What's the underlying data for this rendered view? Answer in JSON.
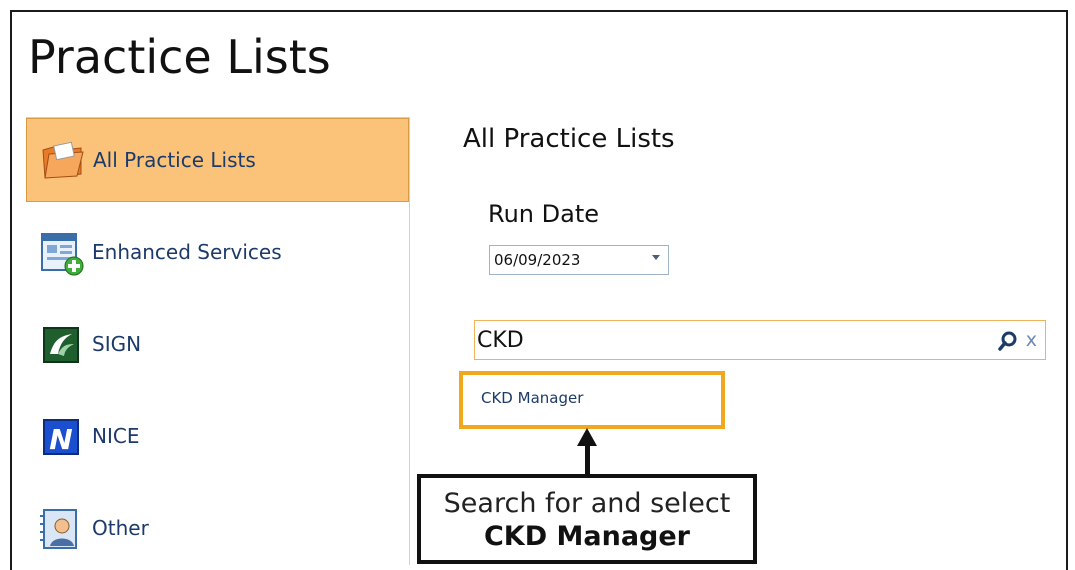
{
  "page": {
    "title": "Practice Lists"
  },
  "sidebar": {
    "items": [
      {
        "label": "All Practice Lists",
        "icon": "folder-icon",
        "active": true
      },
      {
        "label": "Enhanced Services",
        "icon": "enhanced-services-icon",
        "active": false
      },
      {
        "label": "SIGN",
        "icon": "sign-icon",
        "active": false
      },
      {
        "label": "NICE",
        "icon": "nice-icon",
        "active": false
      },
      {
        "label": "Other",
        "icon": "other-icon",
        "active": false
      }
    ]
  },
  "main": {
    "heading": "All Practice Lists",
    "run_date_label": "Run Date",
    "run_date_value": "06/09/2023",
    "search_value": "CKD",
    "clear_glyph": "x",
    "results": [
      "CKD Manager"
    ]
  },
  "callout": {
    "line1": "Search for and select",
    "line2": "CKD Manager"
  },
  "colors": {
    "active_bg": "#fbc27a",
    "highlight_border": "#f0a81e",
    "link": "#1d3b6a"
  }
}
